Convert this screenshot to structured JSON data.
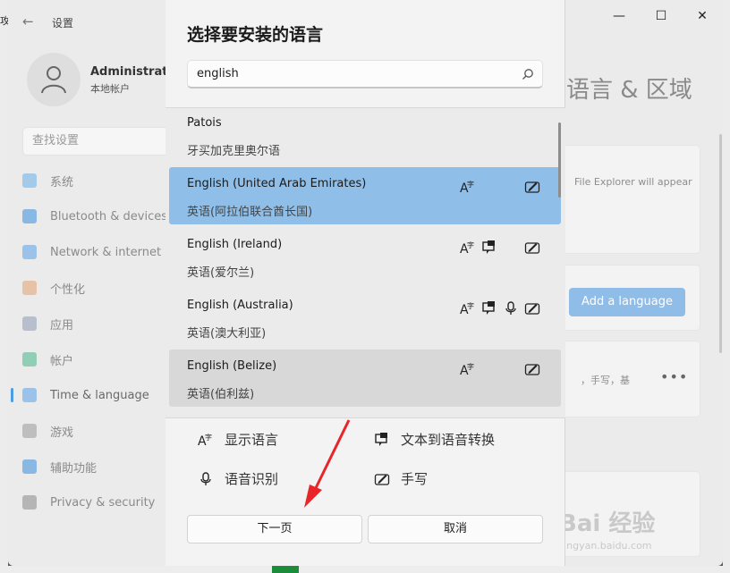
{
  "outer": {
    "fragment_label": "攻"
  },
  "settings": {
    "app_title": "设置",
    "profile": {
      "name": "Administrator",
      "type": "本地帐户"
    },
    "search_placeholder": "查找设置",
    "nav": [
      {
        "label": "系统",
        "icon": "monitor-icon",
        "color": "#6aaee8"
      },
      {
        "label": "Bluetooth & devices",
        "icon": "bluetooth-icon",
        "color": "#3a8ee0"
      },
      {
        "label": "Network & internet",
        "icon": "wifi-icon",
        "color": "#5aa0e6"
      },
      {
        "label": "个性化",
        "icon": "brush-icon",
        "color": "#e4a070"
      },
      {
        "label": "应用",
        "icon": "apps-icon",
        "color": "#8a9bb0"
      },
      {
        "label": "帐户",
        "icon": "person-icon",
        "color": "#49b48a"
      },
      {
        "label": "Time & language",
        "icon": "globe-clock-icon",
        "color": "#5aa0e6"
      },
      {
        "label": "游戏",
        "icon": "gamepad-icon",
        "color": "#999999"
      },
      {
        "label": "辅助功能",
        "icon": "accessibility-icon",
        "color": "#3a8ee0"
      },
      {
        "label": "Privacy & security",
        "icon": "shield-icon",
        "color": "#888888"
      }
    ],
    "active_nav": "Time & language",
    "page_title": "语言 & 区域",
    "card1_text": "File Explorer will appear",
    "add_language_label": "Add a language",
    "card3_text": "，手写，基",
    "watermark": "Bai 经验",
    "watermark_sub": "jingyan.baidu.com"
  },
  "dialog": {
    "title": "选择要安装的语言",
    "search_value": "english",
    "languages": [
      {
        "name": "Patois",
        "native": "牙买加克里奥尔语",
        "features": [],
        "state": "normal"
      },
      {
        "name": "English (United Arab Emirates)",
        "native": "英语(阿拉伯联合酋长国)",
        "features": [
          "display",
          "handwriting"
        ],
        "state": "selected"
      },
      {
        "name": "English (Ireland)",
        "native": "英语(爱尔兰)",
        "features": [
          "display",
          "tts",
          "handwriting"
        ],
        "state": "normal"
      },
      {
        "name": "English (Australia)",
        "native": "英语(澳大利亚)",
        "features": [
          "display",
          "tts",
          "speech",
          "handwriting"
        ],
        "state": "normal"
      },
      {
        "name": "English (Belize)",
        "native": "英语(伯利兹)",
        "features": [
          "display",
          "handwriting"
        ],
        "state": "hover"
      }
    ],
    "legend": {
      "display": "显示语言",
      "tts": "文本到语音转换",
      "speech": "语音识别",
      "handwriting": "手写"
    },
    "next_label": "下一页",
    "cancel_label": "取消"
  }
}
